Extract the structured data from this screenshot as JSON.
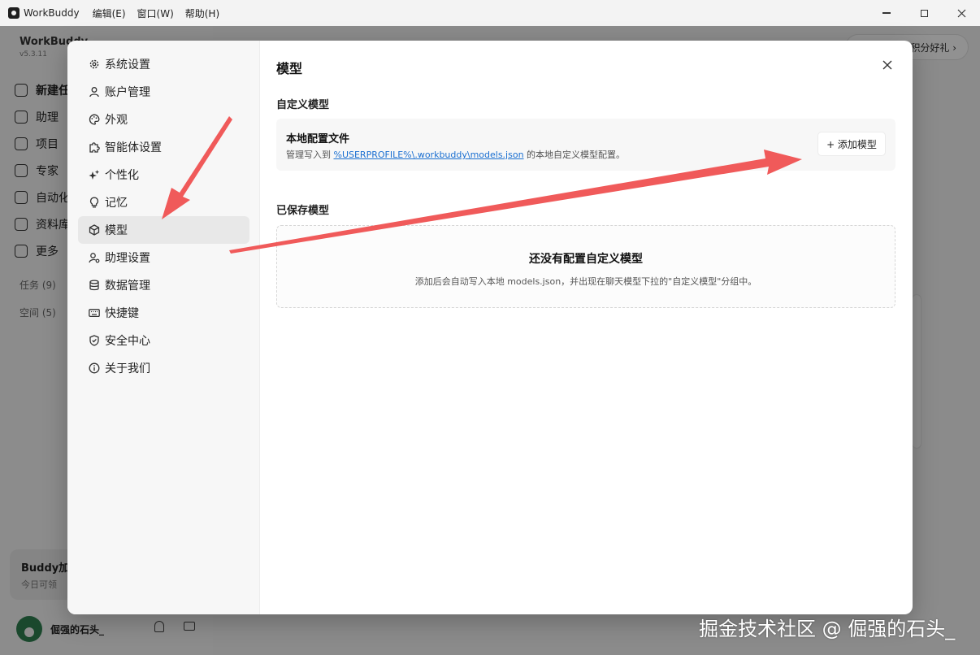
{
  "window": {
    "app_name": "WorkBuddy",
    "menus": [
      "编辑(E)",
      "窗口(W)",
      "帮助(H)"
    ]
  },
  "background": {
    "brand": "WorkBuddy",
    "version": "v5.3.11",
    "nav": [
      "新建任",
      "助理",
      "项目",
      "专家",
      "自动化",
      "资料库",
      "更多"
    ],
    "tasks_label": "任务 (9)",
    "spaces_label": "空间 (5)",
    "promo_title": "Buddy加",
    "promo_sub": "今日可领",
    "user_name": "倔强的石头_",
    "pill_text": "积分好礼 ›"
  },
  "dialog": {
    "nav": [
      {
        "label": "系统设置",
        "icon": "gear-icon"
      },
      {
        "label": "账户管理",
        "icon": "user-icon"
      },
      {
        "label": "外观",
        "icon": "palette-icon"
      },
      {
        "label": "智能体设置",
        "icon": "puzzle-icon"
      },
      {
        "label": "个性化",
        "icon": "sparkles-icon"
      },
      {
        "label": "记忆",
        "icon": "lightbulb-icon"
      },
      {
        "label": "模型",
        "icon": "cube-icon",
        "active": true
      },
      {
        "label": "助理设置",
        "icon": "user-settings-icon"
      },
      {
        "label": "数据管理",
        "icon": "database-icon"
      },
      {
        "label": "快捷键",
        "icon": "keyboard-icon"
      },
      {
        "label": "安全中心",
        "icon": "shield-icon"
      },
      {
        "label": "关于我们",
        "icon": "info-icon"
      }
    ],
    "title": "模型",
    "custom_section": "自定义模型",
    "config_title": "本地配置文件",
    "config_desc_prefix": "管理写入到 ",
    "config_path": "%USERPROFILE%\\.workbuddy\\models.json",
    "config_desc_suffix": " 的本地自定义模型配置。",
    "add_button": "+ 添加模型",
    "saved_section": "已保存模型",
    "empty_title": "还没有配置自定义模型",
    "empty_desc": "添加后会自动写入本地 models.json，并出现在聊天模型下拉的\"自定义模型\"分组中。"
  },
  "annotation_color": "#f05a5a",
  "watermark": "掘金技术社区 @ 倔强的石头_"
}
